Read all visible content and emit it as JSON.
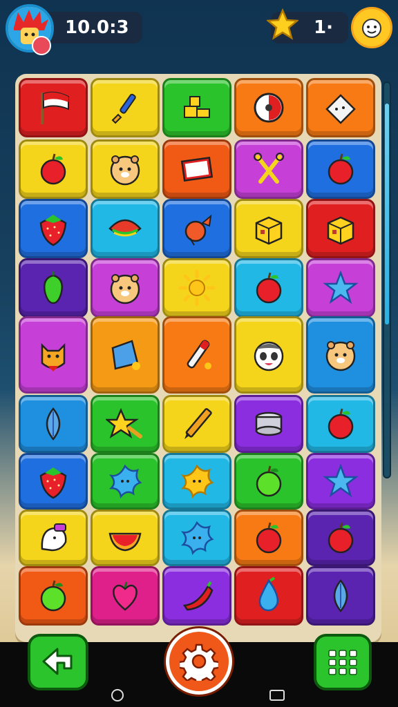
{
  "hud": {
    "score": "10.0:3",
    "stars": "1·",
    "avatar_icon": "spiky-red-hair-avatar-icon",
    "profile_icon": "smiley-face-icon",
    "star_icon": "gold-star-icon"
  },
  "board": {
    "rows": [
      [
        {
          "color": "#e02020",
          "icon": "flag"
        },
        {
          "color": "#f5d51b",
          "icon": "paintbrush"
        },
        {
          "color": "#2bc32b",
          "icon": "blocks"
        },
        {
          "color": "#f77a14",
          "icon": "compass"
        },
        {
          "color": "#f77a14",
          "icon": "eraser"
        }
      ],
      [
        {
          "color": "#f5d51b",
          "icon": "apple"
        },
        {
          "color": "#f5d51b",
          "icon": "hamster"
        },
        {
          "color": "#f05a14",
          "icon": "book"
        },
        {
          "color": "#c640d8",
          "icon": "scissors"
        },
        {
          "color": "#1f6fe0",
          "icon": "apple"
        }
      ],
      [
        {
          "color": "#1f6fe0",
          "icon": "strawberry"
        },
        {
          "color": "#22b8e6",
          "icon": "leaf"
        },
        {
          "color": "#1f6fe0",
          "icon": "fish"
        },
        {
          "color": "#f5d51b",
          "icon": "box"
        },
        {
          "color": "#e02020",
          "icon": "box"
        }
      ],
      [
        {
          "color": "#5a24b0",
          "icon": "pepper"
        },
        {
          "color": "#c640d8",
          "icon": "hamster"
        },
        {
          "color": "#f5d51b",
          "icon": "sun"
        },
        {
          "color": "#22b8e6",
          "icon": "apple"
        },
        {
          "color": "#c640d8",
          "icon": "star"
        }
      ],
      [
        {
          "color": "#c640d8",
          "icon": "cat"
        },
        {
          "color": "#f59a14",
          "icon": "pouch"
        },
        {
          "color": "#f77a14",
          "icon": "pen"
        },
        {
          "color": "#f5d51b",
          "icon": "panda"
        },
        {
          "color": "#1f8fe0",
          "icon": "hamster"
        }
      ],
      [
        {
          "color": "#1f8fe0",
          "icon": "leaf-blue"
        },
        {
          "color": "#2bc32b",
          "icon": "star-yellow"
        },
        {
          "color": "#f5d51b",
          "icon": "pencil"
        },
        {
          "color": "#8a2ee0",
          "icon": "can"
        },
        {
          "color": "#22b8e6",
          "icon": "apple"
        }
      ],
      [
        {
          "color": "#1f6fe0",
          "icon": "strawberry"
        },
        {
          "color": "#2bc32b",
          "icon": "splat-blue"
        },
        {
          "color": "#22b8e6",
          "icon": "splat-yellow"
        },
        {
          "color": "#2bc32b",
          "icon": "apple-green"
        },
        {
          "color": "#8a2ee0",
          "icon": "star"
        }
      ],
      [
        {
          "color": "#f5d51b",
          "icon": "ghost"
        },
        {
          "color": "#f5d51b",
          "icon": "melon"
        },
        {
          "color": "#22b8e6",
          "icon": "splat-blue"
        },
        {
          "color": "#f77a14",
          "icon": "apple"
        },
        {
          "color": "#5a24b0",
          "icon": "apple"
        }
      ],
      [
        {
          "color": "#f05a14",
          "icon": "apple-green"
        },
        {
          "color": "#e0208a",
          "icon": "heart-fruit"
        },
        {
          "color": "#8a2ee0",
          "icon": "chili"
        },
        {
          "color": "#e02020",
          "icon": "drop"
        },
        {
          "color": "#5a24b0",
          "icon": "leaf-blue"
        }
      ]
    ]
  },
  "controls": {
    "back_icon": "back-arrow-icon",
    "settings_icon": "gear-icon",
    "menu_icon": "grid-menu-icon"
  },
  "nav": {
    "home_icon": "circle-home-icon",
    "recent_icon": "square-recents-icon"
  }
}
